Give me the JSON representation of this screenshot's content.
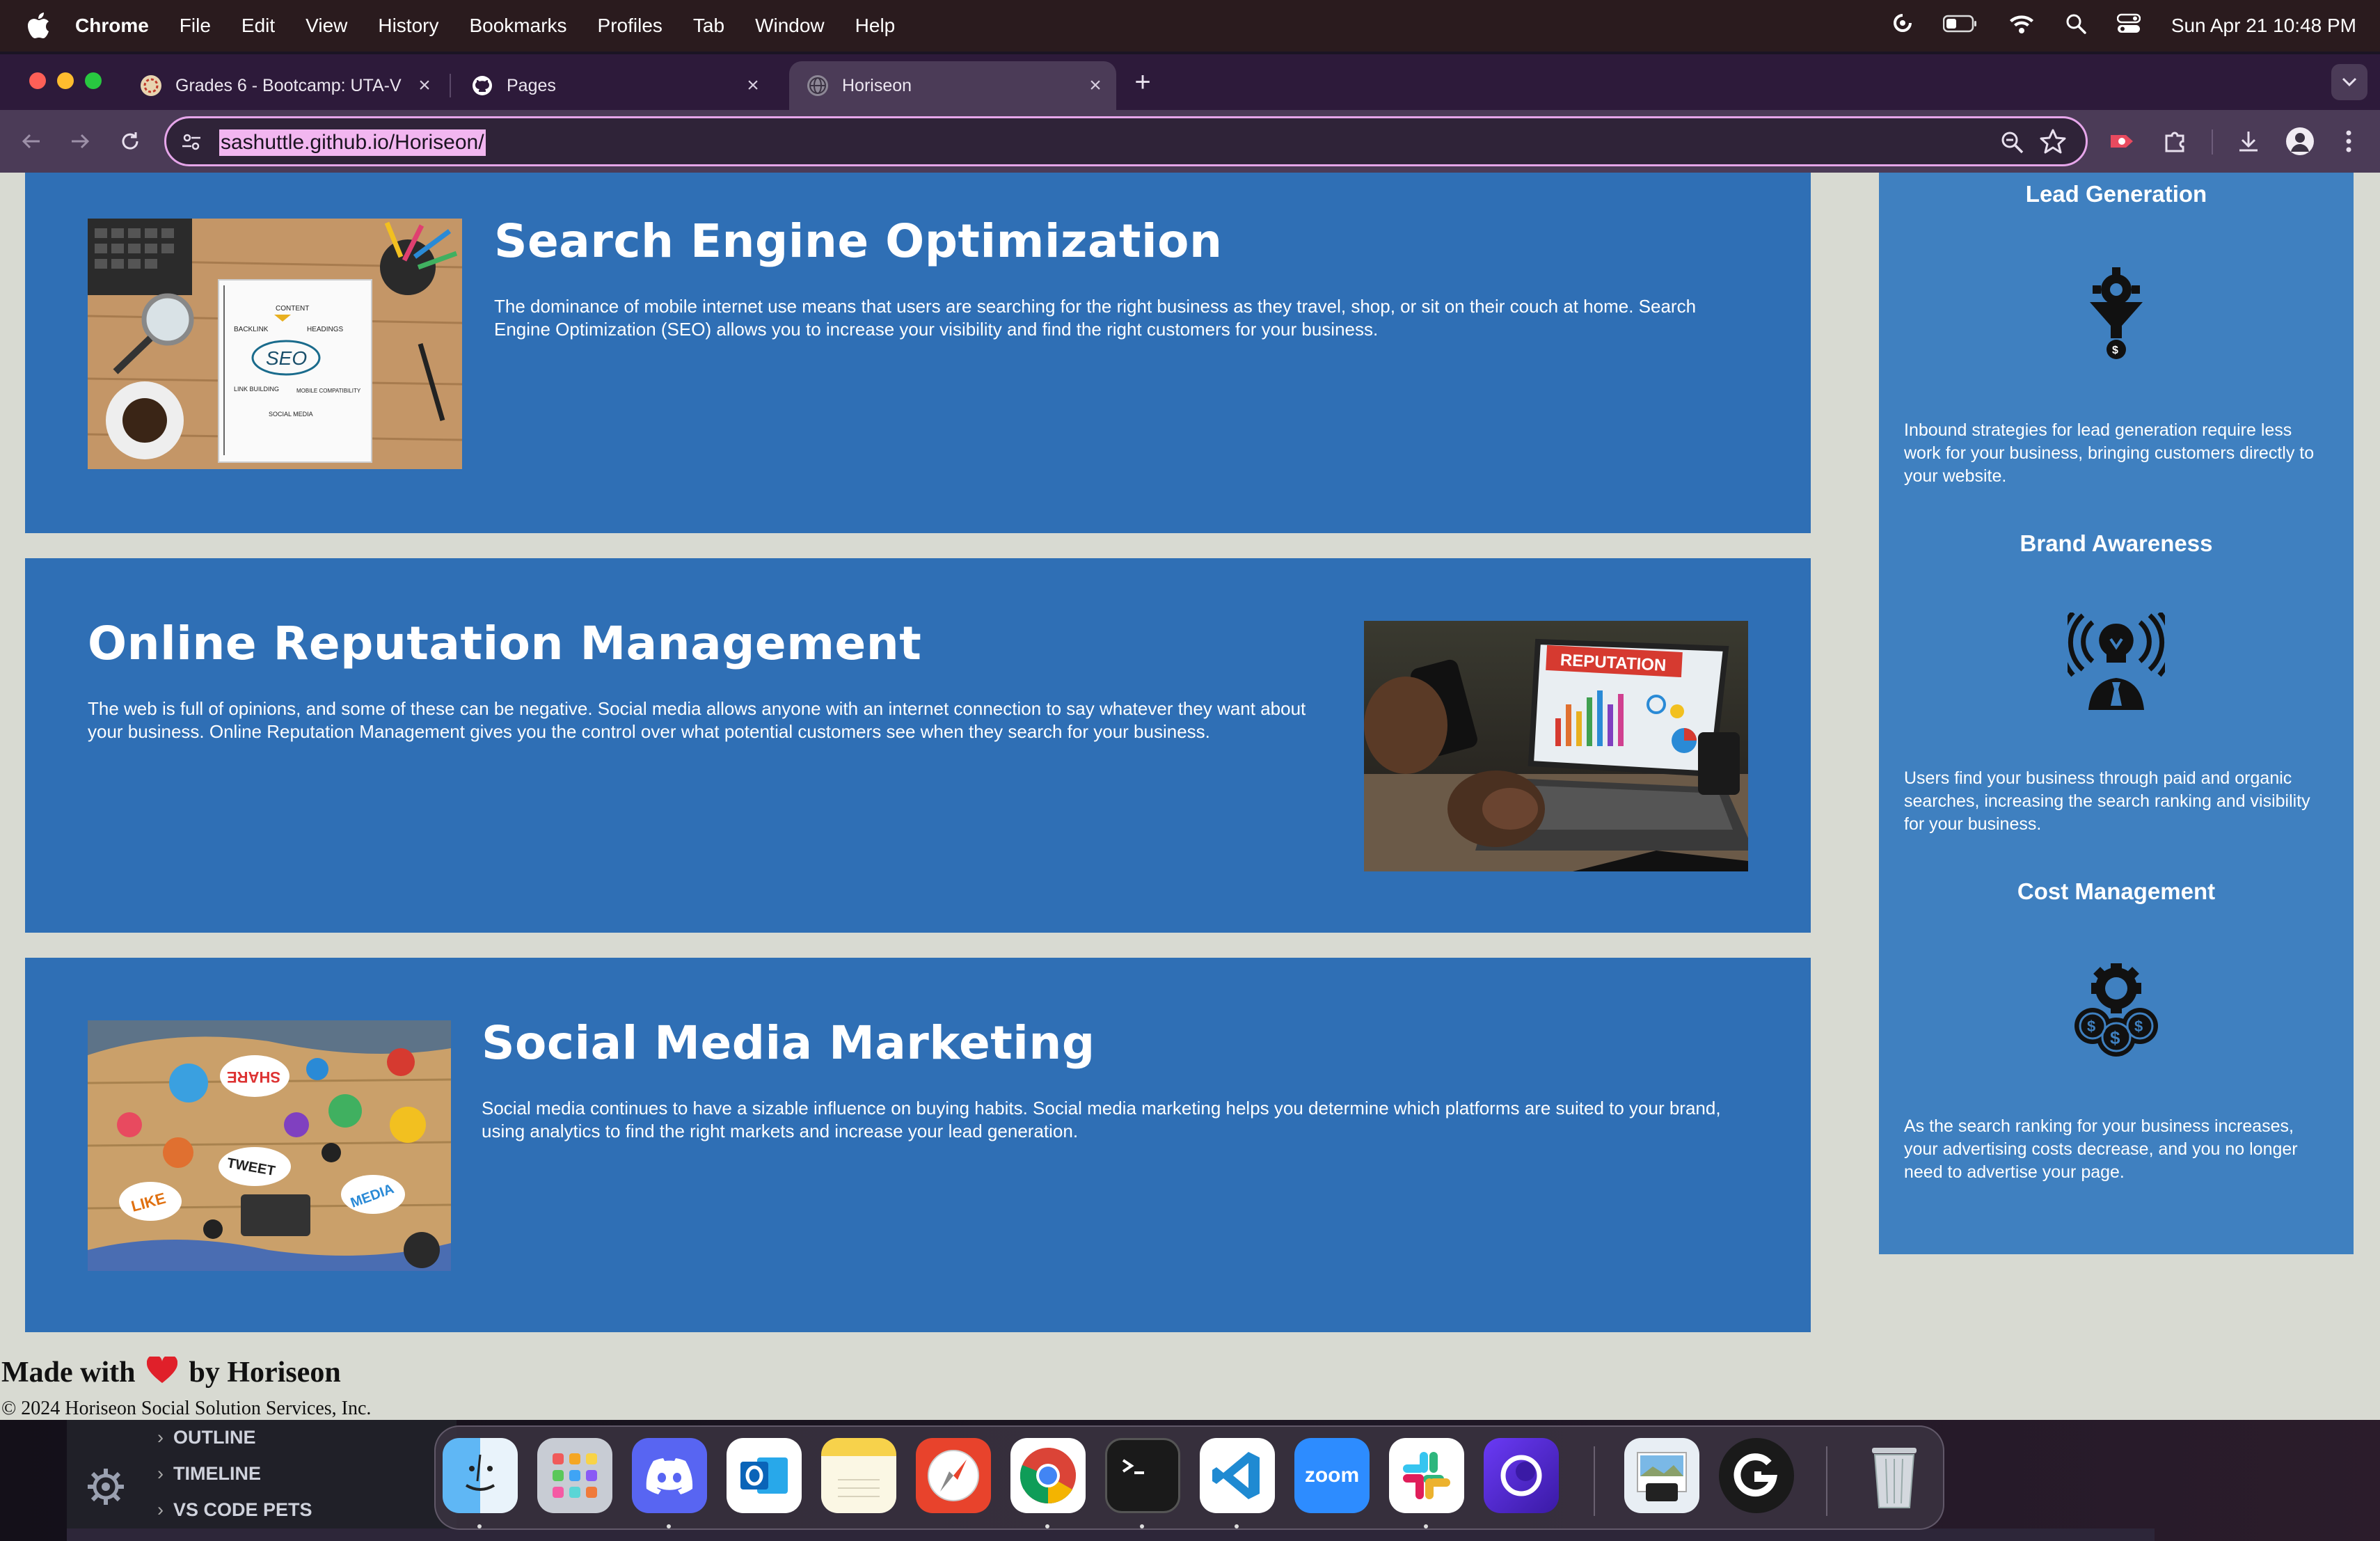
{
  "menubar": {
    "app_name": "Chrome",
    "items": [
      "File",
      "Edit",
      "View",
      "History",
      "Bookmarks",
      "Profiles",
      "Tab",
      "Window",
      "Help"
    ],
    "clock": "Sun Apr 21  10:48 PM"
  },
  "tabs": [
    {
      "title": "Grades 6 - Bootcamp: UTA-V",
      "active": false
    },
    {
      "title": "Pages",
      "active": false
    },
    {
      "title": "Horiseon",
      "active": true
    }
  ],
  "omnibox": {
    "url": "sashuttle.github.io/Horiseon/"
  },
  "content": {
    "cards": [
      {
        "title": "Search Engine Optimization",
        "text": "The dominance of mobile internet use means that users are searching for the right business as they travel, shop, or sit on their couch at home. Search Engine Optimization (SEO) allows you to increase your visibility and find the right customers for your business."
      },
      {
        "title": "Online Reputation Management",
        "text": "The web is full of opinions, and some of these can be negative. Social media allows anyone with an internet connection to say whatever they want about your business. Online Reputation Management gives you the control over what potential customers see when they search for your business."
      },
      {
        "title": "Social Media Marketing",
        "text": "Social media continues to have a sizable influence on buying habits. Social media marketing helps you determine which platforms are suited to your brand, using analytics to find the right markets and increase your lead generation."
      }
    ],
    "images": {
      "seo_words": [
        "CONTENT",
        "BACKLINK",
        "HEADINGS",
        "SEO",
        "LINK BUILDING",
        "MOBILE COMPATIBILITY",
        "SOCIAL MEDIA"
      ],
      "reputation_banner": "REPUTATION",
      "social_words": [
        "SHARE",
        "TWEET",
        "LIKE",
        "MEDIA"
      ]
    }
  },
  "aside": {
    "benefits": [
      {
        "title": "Lead Generation",
        "icon": "lead-generation-icon",
        "text": "Inbound strategies for lead generation require less work for your business, bringing customers directly to your website."
      },
      {
        "title": "Brand Awareness",
        "icon": "brand-awareness-icon",
        "text": "Users find your business through paid and organic searches, increasing the search ranking and visibility for your business."
      },
      {
        "title": "Cost Management",
        "icon": "cost-management-icon",
        "text": "As the search ranking for your business increases, your advertising costs decrease, and you no longer need to advertise your page."
      }
    ]
  },
  "footer": {
    "made_prefix": "Made with",
    "made_suffix": "by Horiseon",
    "copyright": "© 2024 Horiseon Social Solution Services, Inc."
  },
  "vscode": {
    "sections": [
      "OUTLINE",
      "TIMELINE",
      "VS CODE PETS"
    ]
  },
  "dock": {
    "apps": [
      "Finder",
      "Launchpad",
      "Discord",
      "Outlook",
      "Notes",
      "Safari",
      "Chrome",
      "Terminal",
      "VS Code",
      "zoom",
      "Slack",
      "Arc",
      "Preview",
      "Logitech G HUB",
      "Trash"
    ]
  },
  "colors": {
    "card_blue": "#2f6fb5",
    "aside_blue": "#3f80c0",
    "page_bg": "#d8dad2",
    "url_highlight": "#f2b6f0"
  }
}
